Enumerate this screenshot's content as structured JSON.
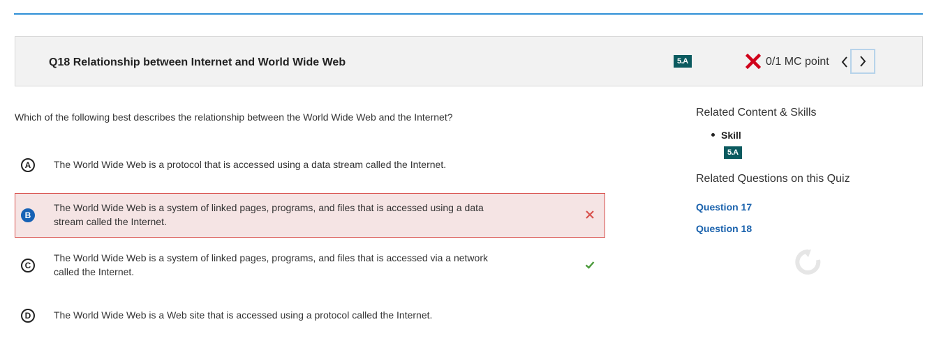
{
  "question": {
    "title": "Q18 Relationship between Internet and World Wide Web",
    "skill_badge": "5.A",
    "score": "0/1 MC point",
    "prompt": "Which of the following best describes the relationship between the World Wide Web and the Internet?"
  },
  "choices": [
    {
      "letter": "A",
      "text": "The World Wide Web is a protocol that is accessed using a data stream called the Internet."
    },
    {
      "letter": "B",
      "text": "The World Wide Web is a system of linked pages, programs, and files that is accessed using a data stream called the Internet."
    },
    {
      "letter": "C",
      "text": "The World Wide Web is a system of linked pages, programs, and files that is accessed via a network called the Internet."
    },
    {
      "letter": "D",
      "text": "The World Wide Web is a Web site that is accessed using a protocol called the Internet."
    }
  ],
  "sidebar": {
    "related_heading": "Related Content & Skills",
    "skill_label": "Skill",
    "skill_badge": "5.A",
    "questions_heading": "Related Questions on this Quiz",
    "questions": [
      "Question 17",
      "Question 18"
    ]
  },
  "colors": {
    "accent_line": "#2f8fd6",
    "badge": "#0b5a5f",
    "incorrect": "#d9534f",
    "correct": "#4a9a3a",
    "link": "#1a62ad",
    "selected": "#1762b5"
  },
  "icons": {
    "score": "red-x-icon",
    "prev": "chevron-left-icon",
    "next": "chevron-right-icon",
    "wrong": "x-mark-icon",
    "right": "checkmark-icon",
    "loading": "refresh-spinner-icon"
  }
}
